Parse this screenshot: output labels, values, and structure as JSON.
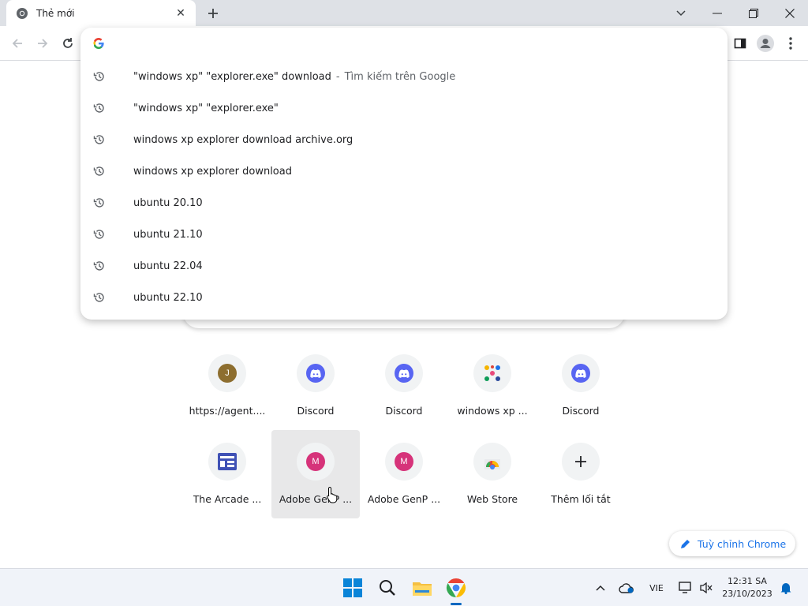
{
  "tab": {
    "title": "Thẻ mới",
    "close_icon": "close-icon"
  },
  "colors": {
    "accent": "#1a73e8",
    "discord": "#5865f2",
    "taskbar": "#f0f3f9",
    "hover_tile": "#e8e8e9"
  },
  "omnibox": {
    "value": "",
    "suggestions": [
      {
        "text": "\"windows xp\" \"explorer.exe\" download",
        "separator": "-",
        "description": "Tìm kiếm trên Google"
      },
      {
        "text": "\"windows xp\" \"explorer.exe\""
      },
      {
        "text": "windows xp explorer download archive.org"
      },
      {
        "text": "windows xp explorer download"
      },
      {
        "text": "ubuntu 20.10"
      },
      {
        "text": "ubuntu 21.10"
      },
      {
        "text": "ubuntu 22.04"
      },
      {
        "text": "ubuntu 22.10"
      }
    ]
  },
  "shortcuts": [
    {
      "label": "https://agent....",
      "icon": "letter",
      "letter": "J",
      "color": "#8d6e2f"
    },
    {
      "label": "Discord",
      "icon": "discord"
    },
    {
      "label": "Discord",
      "icon": "discord"
    },
    {
      "label": "windows xp ...",
      "icon": "dots"
    },
    {
      "label": "Discord",
      "icon": "discord"
    },
    {
      "label": "The Arcade ...",
      "icon": "arcade"
    },
    {
      "label": "Adobe GenP ...",
      "icon": "letter",
      "letter": "M",
      "color": "#d6337a",
      "hovered": true
    },
    {
      "label": "Adobe GenP ...",
      "icon": "letter",
      "letter": "M",
      "color": "#d6337a"
    },
    {
      "label": "Web Store",
      "icon": "webstore"
    },
    {
      "label": "Thêm lối tắt",
      "icon": "plus"
    }
  ],
  "customize_label": "Tuỳ chỉnh Chrome",
  "taskbar": {
    "language": "VIE",
    "time": "12:31 SA",
    "date": "23/10/2023"
  }
}
